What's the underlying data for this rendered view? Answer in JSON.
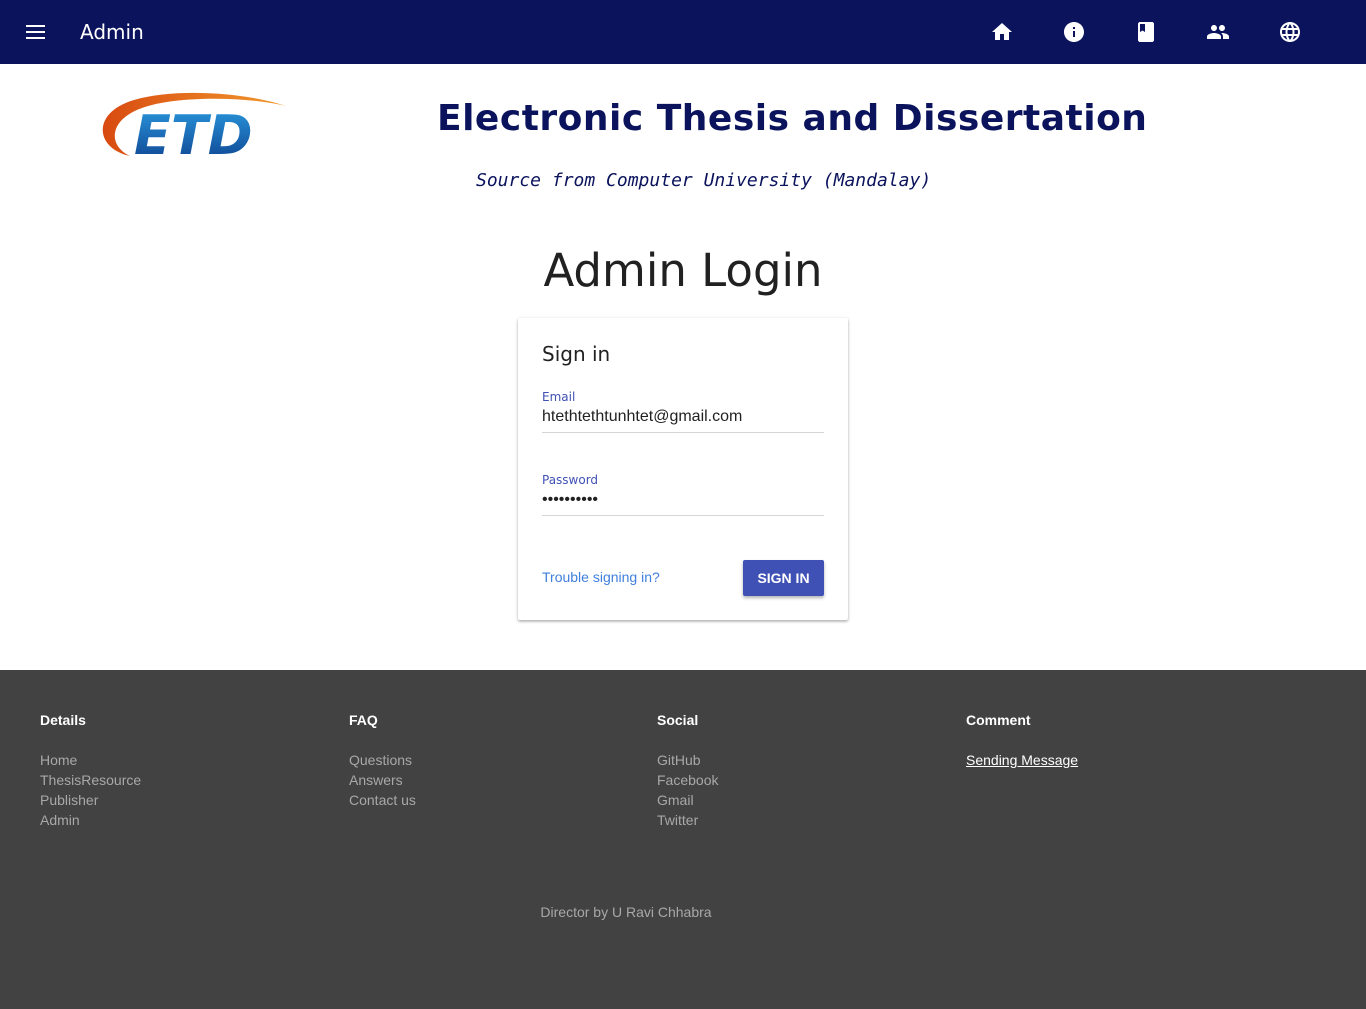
{
  "header": {
    "title": "Admin",
    "icons": [
      "home-icon",
      "info-icon",
      "book-icon",
      "people-icon",
      "globe-icon"
    ],
    "color": "#0a135c"
  },
  "branding": {
    "logo_text": "ETD",
    "title": "Electronic Thesis and Dissertation",
    "subtitle": "Source from Computer University (Mandalay)"
  },
  "page": {
    "heading": "Admin Login"
  },
  "signin": {
    "title": "Sign in",
    "email_label": "Email",
    "email_value": "htethtethtunhtet@gmail.com",
    "password_label": "Password",
    "password_value": "••••••••••",
    "trouble_link": "Trouble signing in?",
    "submit_label": "SIGN IN",
    "accent": "#3f51b5"
  },
  "footer": {
    "columns": [
      {
        "heading": "Details",
        "links": [
          "Home",
          "ThesisResource",
          "Publisher",
          "Admin"
        ]
      },
      {
        "heading": "FAQ",
        "links": [
          "Questions",
          "Answers",
          "Contact us"
        ]
      },
      {
        "heading": "Social",
        "links": [
          "GitHub",
          "Facebook",
          "Gmail",
          "Twitter"
        ]
      },
      {
        "heading": "Comment",
        "links": [
          "Sending Message"
        ]
      }
    ],
    "credit": "Director by U Ravi Chhabra",
    "background": "#424242"
  }
}
